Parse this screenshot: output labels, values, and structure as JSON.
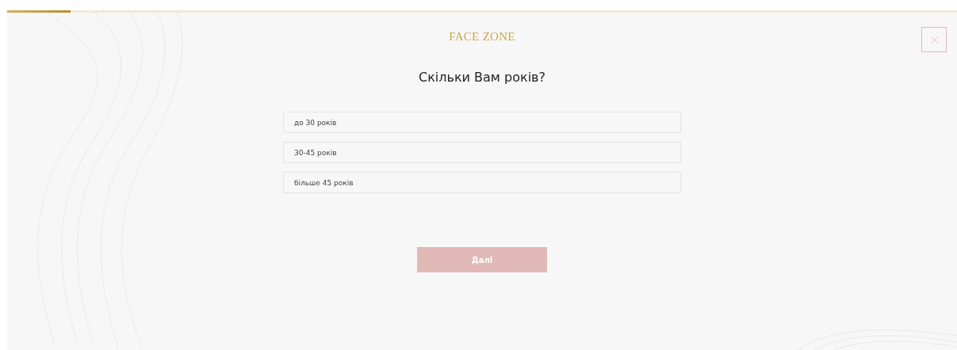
{
  "progress": {
    "level": 0.067
  },
  "logo": "FACE ZONE",
  "question": "Скільки Вам років?",
  "options": [
    {
      "label": "до 30 років",
      "selected": false
    },
    {
      "label": "30-45 років",
      "selected": false
    },
    {
      "label": "більше 45 років",
      "selected": false
    }
  ],
  "next_button": {
    "label": "Далі",
    "disabled": true
  }
}
